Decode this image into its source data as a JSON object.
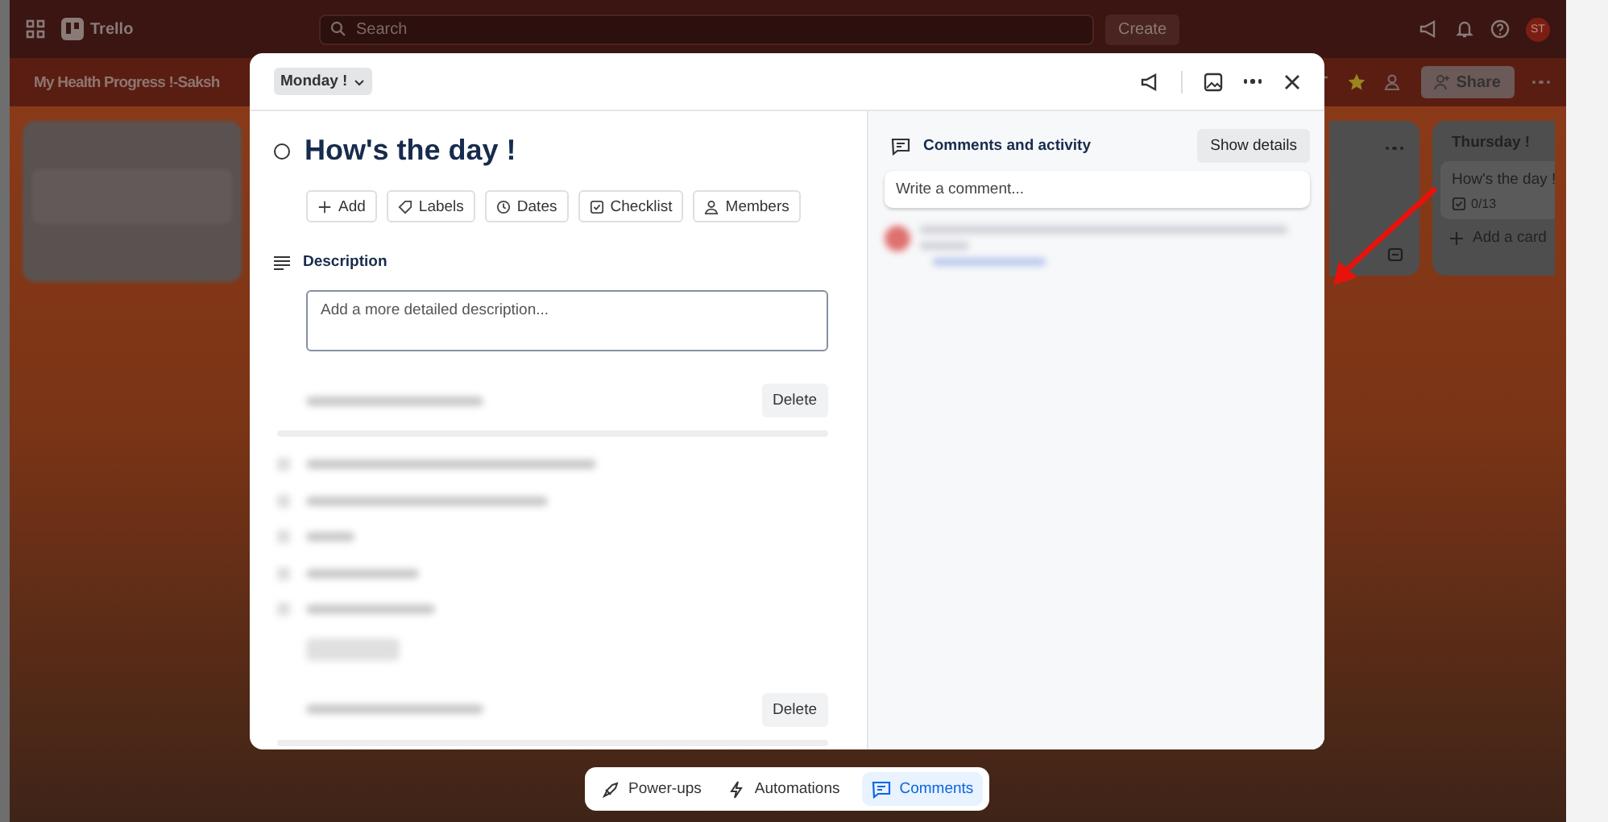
{
  "top_bar": {
    "app_name": "Trello",
    "search": {
      "placeholder": "Search"
    },
    "create_button": "Create",
    "avatar": "ST"
  },
  "board_header": {
    "title": "My Health Progress !-Saksh",
    "share_button": "Share"
  },
  "lists": [
    {
      "title": "Thursday !",
      "cards": [
        {
          "title": "How's the day !",
          "checklist": "0/13"
        }
      ],
      "add_card": "Add a card"
    }
  ],
  "card_modal": {
    "list_chip": "Monday !",
    "title": "How's the day !",
    "completed": false,
    "actions": [
      {
        "label": "Add",
        "kind": "add"
      },
      {
        "label": "Labels",
        "kind": "labels"
      },
      {
        "label": "Dates",
        "kind": "dates"
      },
      {
        "label": "Checklist",
        "kind": "checklist"
      },
      {
        "label": "Members",
        "kind": "members"
      }
    ],
    "description": {
      "heading": "Description",
      "placeholder": "Add a more detailed description..."
    },
    "checklists": [
      {
        "delete_button": "Delete",
        "level": 0
      },
      {
        "delete_button": "Delete",
        "level": 0
      }
    ],
    "activity": {
      "heading": "Comments and activity",
      "show_details_button": "Show details",
      "comment_placeholder": "Write a comment..."
    }
  },
  "bottom_bar": [
    {
      "label": "Power-ups",
      "kind": "powerups",
      "selected": false
    },
    {
      "label": "Automations",
      "kind": "automations",
      "selected": false
    },
    {
      "label": "Comments",
      "kind": "comments",
      "selected": true
    }
  ]
}
